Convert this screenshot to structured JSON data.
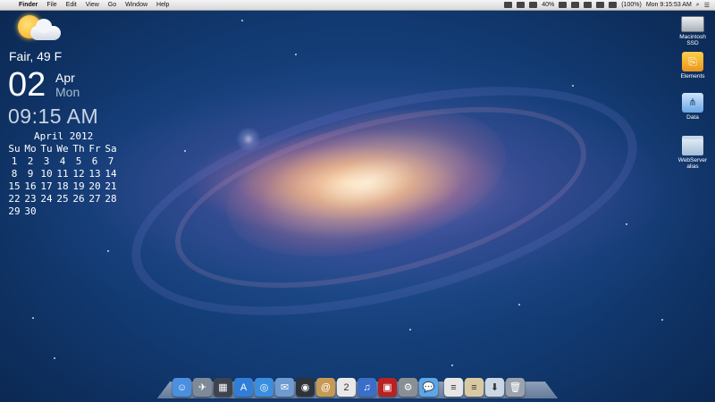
{
  "menubar": {
    "apple_glyph": "",
    "app_name": "Finder",
    "items": [
      "File",
      "Edit",
      "View",
      "Go",
      "Window",
      "Help"
    ],
    "battery_text": "40%",
    "battery_percent_text": "(100%)",
    "clock": "Mon 9:15:53 AM"
  },
  "weather": {
    "icon": "partly-cloudy-icon",
    "condition_temp": "Fair, 49 F"
  },
  "date_widget": {
    "day": "02",
    "month": "Apr",
    "weekday": "Mon",
    "time": "09:15 AM"
  },
  "calendar": {
    "title": "April 2012",
    "weekdays": [
      "Su",
      "Mo",
      "Tu",
      "We",
      "Th",
      "Fr",
      "Sa"
    ],
    "days": [
      "1",
      "2",
      "3",
      "4",
      "5",
      "6",
      "7",
      "8",
      "9",
      "10",
      "11",
      "12",
      "13",
      "14",
      "15",
      "16",
      "17",
      "18",
      "19",
      "20",
      "21",
      "22",
      "23",
      "24",
      "25",
      "26",
      "27",
      "28",
      "29",
      "30"
    ]
  },
  "desktop_icons": [
    {
      "label": "Macintosh SSD",
      "icon": "hard-drive-icon"
    },
    {
      "label": "Elements",
      "icon": "usb-drive-icon"
    },
    {
      "label": "Data",
      "icon": "network-drive-icon"
    },
    {
      "label": "WebServer alias",
      "icon": "folder-alias-icon"
    }
  ],
  "dock": {
    "items": [
      {
        "icon": "finder-icon",
        "glyph": "☺",
        "color": "#4a8fe0"
      },
      {
        "icon": "launchpad-icon",
        "glyph": "✈",
        "color": "#7f8a99"
      },
      {
        "icon": "mission-control-icon",
        "glyph": "▦",
        "color": "#3d4450"
      },
      {
        "icon": "app-store-icon",
        "glyph": "A",
        "color": "#2f7fd9"
      },
      {
        "icon": "safari-icon",
        "glyph": "◎",
        "color": "#3b8de0"
      },
      {
        "icon": "mail-icon",
        "glyph": "✉",
        "color": "#6f9bd1"
      },
      {
        "icon": "facetime-icon",
        "glyph": "◉",
        "color": "#2d333b"
      },
      {
        "icon": "contacts-icon",
        "glyph": "@",
        "color": "#c79a54"
      },
      {
        "icon": "calendar-icon",
        "glyph": "2",
        "color": "#e8e8e8"
      },
      {
        "icon": "itunes-icon",
        "glyph": "♫",
        "color": "#3a6ec8"
      },
      {
        "icon": "photo-booth-icon",
        "glyph": "▣",
        "color": "#b82222"
      },
      {
        "icon": "system-preferences-icon",
        "glyph": "⚙",
        "color": "#8a8f96"
      },
      {
        "icon": "messages-icon",
        "glyph": "💬",
        "color": "#5aa6e8"
      },
      {
        "icon": "documents-stack-icon",
        "glyph": "≡",
        "color": "#e6e6e6"
      },
      {
        "icon": "text-document-icon",
        "glyph": "≡",
        "color": "#d9c9a3"
      },
      {
        "icon": "downloads-stack-icon",
        "glyph": "⬇",
        "color": "#c9d6e4"
      },
      {
        "icon": "trash-icon",
        "glyph": "🗑",
        "color": "#9aa3ad"
      }
    ]
  }
}
